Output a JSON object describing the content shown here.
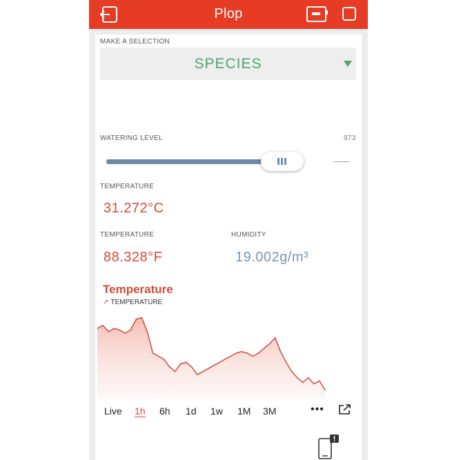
{
  "app": {
    "title": "Plop"
  },
  "selection": {
    "label": "MAKE A SELECTION",
    "value": "SPECIES"
  },
  "watering": {
    "label": "WATERING LEVEL",
    "value": "973",
    "level_fraction": 0.88
  },
  "temperature_c": {
    "label": "TEMPERATURE",
    "value": "31.272°C"
  },
  "temperature_f": {
    "label": "TEMPERATURE",
    "value": "88.328°F"
  },
  "humidity": {
    "label": "HUMIDITY",
    "value": "19.002g/m³"
  },
  "chart": {
    "title": "Temperature",
    "legend": "TEMPERATURE",
    "time_ranges": [
      "Live",
      "1h",
      "6h",
      "1d",
      "1w",
      "1M",
      "3M"
    ],
    "active_range": "1h",
    "more_label": "•••"
  },
  "colors": {
    "topbar": "#e63b25",
    "accent_red": "#d24a3b",
    "accent_green": "#4fa56b",
    "accent_blue": "#7a95ad",
    "slider": "#6e8aa4"
  },
  "icons": {
    "back": "exit-icon",
    "device": "device-icon",
    "square": "square-icon",
    "dropdown": "caret-down-icon",
    "export": "external-link-icon",
    "notification_device": "phone-alert-icon"
  },
  "chart_data": {
    "type": "area",
    "title": "Temperature",
    "series": [
      {
        "name": "TEMPERATURE",
        "values": [
          80,
          82,
          78,
          80,
          79,
          77,
          79,
          86,
          87,
          78,
          64,
          62,
          60,
          55,
          52,
          57,
          58,
          55,
          50,
          52,
          54,
          56,
          58,
          60,
          62,
          64,
          65,
          64,
          62,
          64,
          67,
          70,
          74,
          65,
          58,
          52,
          48,
          45,
          48,
          44,
          46,
          40
        ]
      }
    ]
  }
}
